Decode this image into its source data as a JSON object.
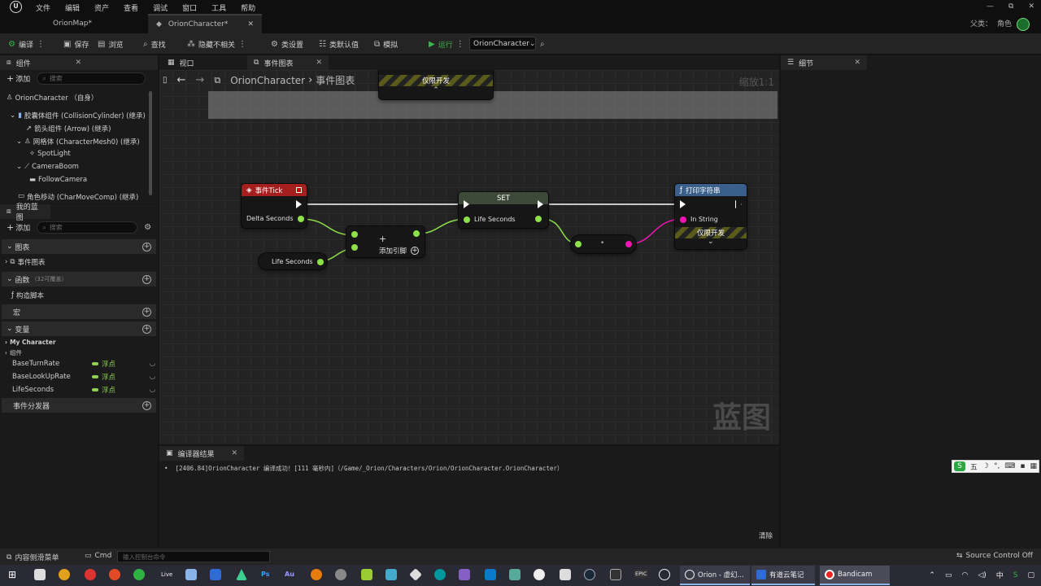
{
  "menu": {
    "logo": "U",
    "items": [
      "文件",
      "编辑",
      "资产",
      "查看",
      "调试",
      "窗口",
      "工具",
      "帮助"
    ]
  },
  "window_controls": {
    "minimize": "—",
    "restore": "⧉",
    "close": "✕"
  },
  "doc_tabs": [
    {
      "label": "OrionMap*",
      "active": false
    },
    {
      "label": "OrionCharacter*",
      "active": true
    }
  ],
  "parent_class": {
    "prefix": "父类：",
    "value": "角色"
  },
  "toolbar": {
    "compile": "编译",
    "save": "保存",
    "browse": "浏览",
    "find": "查找",
    "hide_unrelated": "隐藏不相关",
    "class_settings": "类设置",
    "class_defaults": "类默认值",
    "simulate": "模拟",
    "run": "运行",
    "debug_target": "OrionCharacter"
  },
  "components_panel": {
    "title": "组件",
    "add": "添加",
    "search_placeholder": "搜索",
    "items": [
      {
        "label": "OrionCharacter （自身）"
      },
      {
        "label": "胶囊体组件 (CollisionCylinder) (继承)"
      },
      {
        "label": "箭头组件 (Arrow) (继承)"
      },
      {
        "label": "网格体 (CharacterMesh0) (继承)"
      },
      {
        "label": "SpotLight"
      },
      {
        "label": "CameraBoom"
      },
      {
        "label": "FollowCamera"
      },
      {
        "label": "角色移动 (CharMoveComp) (继承)"
      }
    ]
  },
  "mybp_panel": {
    "title": "我的蓝图",
    "add": "添加",
    "search_placeholder": "搜索",
    "sections": {
      "graphs": "图表",
      "event_graph": "事件图表",
      "functions": "函数",
      "functions_badge": "（32可覆盖）",
      "construction": "构造脚本",
      "macros": "宏",
      "variables": "变量",
      "my_character": "My Character",
      "components": "组件",
      "dispatchers": "事件分发器"
    },
    "variables": [
      {
        "name": "BaseTurnRate",
        "type": "浮点"
      },
      {
        "name": "BaseLookUpRate",
        "type": "浮点"
      },
      {
        "name": "LifeSeconds",
        "type": "浮点"
      }
    ]
  },
  "graph_tabs": [
    {
      "label": "视口",
      "active": false
    },
    {
      "label": "事件图表",
      "active": true
    }
  ],
  "graph": {
    "breadcrumb_root": "OrionCharacter",
    "breadcrumb_sep": "›",
    "breadcrumb_leaf": "事件图表",
    "zoom": "缩放1:1",
    "top_node_label": "仅限开发",
    "watermark": "蓝图",
    "nodes": {
      "event_tick": {
        "title": "事件Tick",
        "pin": "Delta Seconds",
        "color": "#a51f1f"
      },
      "add": {
        "plus": "+",
        "label": "添加引脚"
      },
      "life_get": {
        "label": "Life Seconds"
      },
      "set": {
        "title": "SET",
        "pin": "Life Seconds"
      },
      "convert": {
        "label": "•"
      },
      "print": {
        "title": "打印字符串",
        "pin": "In String",
        "dev_only": "仅限开发",
        "color": "#3a5f8a"
      }
    }
  },
  "details_panel": {
    "title": "细节"
  },
  "compiler": {
    "title": "编译器结果",
    "log": "[2406.84]OrionCharacter 编译成功！[111 毫秒内]（/Game/_Orion/Characters/Orion/OrionCharacter.OrionCharacter）",
    "clear": "清除"
  },
  "statusbar": {
    "content_drawer": "内容侧滑菜单",
    "cmd": "Cmd",
    "cmd_placeholder": "输入控制台命令",
    "source_control": "Source Control Off"
  },
  "ime": {
    "label": "五"
  },
  "taskbar": {
    "apps": [
      {
        "label": "Orion - 虚幻..."
      },
      {
        "label": "有道云笔记"
      },
      {
        "label": "Bandicam"
      }
    ],
    "live": "Live",
    "ps": "Ps",
    "au": "Au",
    "epic": "EPIC",
    "tray_lang": "中"
  }
}
